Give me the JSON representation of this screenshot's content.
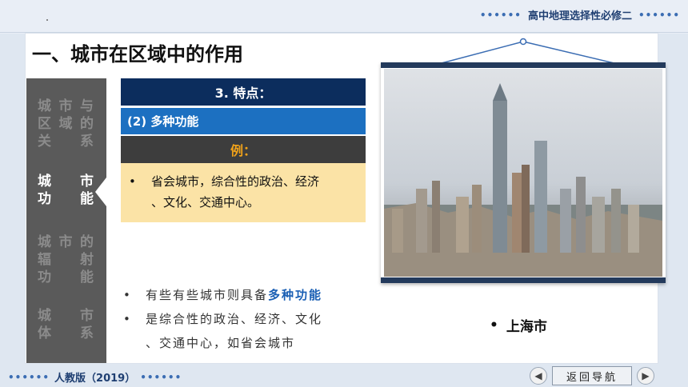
{
  "header": {
    "course_title": "高中地理选择性必修二",
    "dots_left": "••••••",
    "dots_right": "••••••"
  },
  "section_title": "一、城市在区域中的作用",
  "sidebar": {
    "items": [
      {
        "lines": [
          [
            "城",
            "市",
            "与"
          ],
          [
            "区",
            "域",
            "的"
          ],
          [
            "关",
            "",
            "系"
          ]
        ],
        "active": false
      },
      {
        "lines": [
          [
            "城",
            "",
            "市"
          ],
          [
            "功",
            "",
            "能"
          ]
        ],
        "active": true
      },
      {
        "lines": [
          [
            "城",
            "市",
            "的"
          ],
          [
            "辐",
            "",
            "射"
          ],
          [
            "功",
            "",
            "能"
          ]
        ],
        "active": false
      },
      {
        "lines": [
          [
            "城",
            "",
            "市"
          ],
          [
            "体",
            "",
            "系"
          ]
        ],
        "active": false
      }
    ]
  },
  "content": {
    "title": "3.  特点：",
    "subtitle": "(2)  多种功能",
    "example_label": "例：",
    "example_bullet": "•",
    "example_text_line1": "省会城市，综合性的政治、经济",
    "example_text_line2": "、文化、交通中心。"
  },
  "notes": {
    "bullet": "•",
    "line1_prefix": "有些有些城市则具备",
    "line1_highlight": "多种功能",
    "line2": "是综合性的政治、经济、文化",
    "line3": "、交通中心，如省会城市"
  },
  "photo": {
    "caption_bullet": "•",
    "caption": "上海市"
  },
  "footer": {
    "publisher": "人教版（2019）",
    "dots_left": "••••••",
    "dots_right": "••••••",
    "back_nav_label": "返回导航",
    "prev_symbol": "◀",
    "next_symbol": "▶"
  },
  "colors": {
    "title_bar": "#0c2d5d",
    "subtitle_bar": "#1c70c1",
    "example_bar": "#3d3d3d",
    "example_label": "#f0a21a",
    "example_box": "#fbe3a6",
    "sidebar": "#5a5a5a",
    "highlight": "#1a5fb4"
  }
}
